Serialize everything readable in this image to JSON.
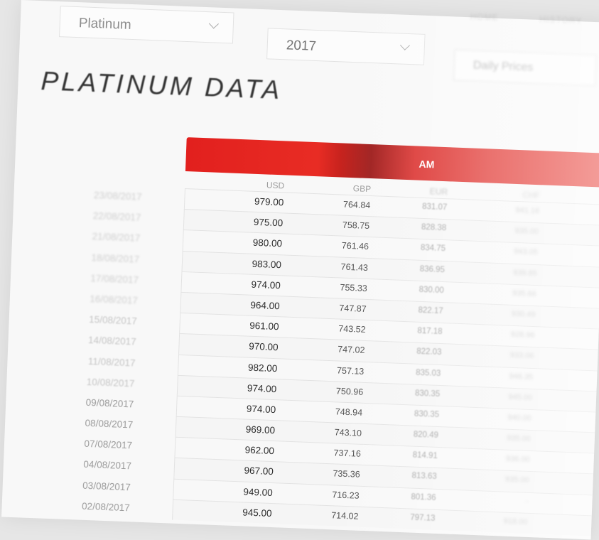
{
  "nav": {
    "item_a": "HOME",
    "item_b": "HISTORY"
  },
  "filters": {
    "metal": "Platinum",
    "year": "2017",
    "view": "Daily Prices"
  },
  "page_title": "PLATINUM DATA",
  "table": {
    "session_label": "AM",
    "columns": [
      "USD",
      "GBP",
      "EUR",
      "CHF"
    ],
    "rows": [
      {
        "date": "23/08/2017",
        "usd": "979.00",
        "gbp": "764.84",
        "eur": "831.07",
        "chf": "941.16"
      },
      {
        "date": "22/08/2017",
        "usd": "975.00",
        "gbp": "758.75",
        "eur": "828.38",
        "chf": "935.00"
      },
      {
        "date": "21/08/2017",
        "usd": "980.00",
        "gbp": "761.46",
        "eur": "834.75",
        "chf": "943.05"
      },
      {
        "date": "18/08/2017",
        "usd": "983.00",
        "gbp": "761.43",
        "eur": "836.95",
        "chf": "939.85"
      },
      {
        "date": "17/08/2017",
        "usd": "974.00",
        "gbp": "755.33",
        "eur": "830.00",
        "chf": "935.66"
      },
      {
        "date": "16/08/2017",
        "usd": "964.00",
        "gbp": "747.87",
        "eur": "822.17",
        "chf": "930.49"
      },
      {
        "date": "15/08/2017",
        "usd": "961.00",
        "gbp": "743.52",
        "eur": "817.18",
        "chf": "928.96"
      },
      {
        "date": "14/08/2017",
        "usd": "970.00",
        "gbp": "747.02",
        "eur": "822.03",
        "chf": "933.06"
      },
      {
        "date": "11/08/2017",
        "usd": "982.00",
        "gbp": "757.13",
        "eur": "835.03",
        "chf": "946.35"
      },
      {
        "date": "10/08/2017",
        "usd": "974.00",
        "gbp": "750.96",
        "eur": "830.35",
        "chf": "945.00"
      },
      {
        "date": "09/08/2017",
        "usd": "974.00",
        "gbp": "748.94",
        "eur": "830.35",
        "chf": "940.00"
      },
      {
        "date": "08/08/2017",
        "usd": "969.00",
        "gbp": "743.10",
        "eur": "820.49",
        "chf": "935.00"
      },
      {
        "date": "07/08/2017",
        "usd": "962.00",
        "gbp": "737.16",
        "eur": "814.91",
        "chf": "936.00"
      },
      {
        "date": "04/08/2017",
        "usd": "967.00",
        "gbp": "735.36",
        "eur": "813.63",
        "chf": "935.00"
      },
      {
        "date": "03/08/2017",
        "usd": "949.00",
        "gbp": "716.23",
        "eur": "801.36",
        "chf": "-"
      },
      {
        "date": "02/08/2017",
        "usd": "945.00",
        "gbp": "714.02",
        "eur": "797.13",
        "chf": "918.00"
      }
    ]
  }
}
